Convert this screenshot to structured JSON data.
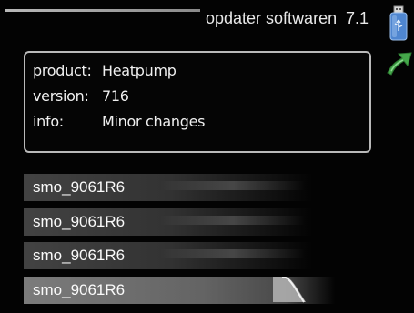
{
  "header": {
    "title": "opdater softwaren",
    "menu_number": "7.1"
  },
  "icons": {
    "usb": "usb-stick-icon",
    "back": "green-arrow-icon"
  },
  "info": {
    "product_label": "product:",
    "product_value": "Heatpump",
    "version_label": "version:",
    "version_value": "716",
    "info_label": "info:",
    "info_value": "Minor changes"
  },
  "files": [
    {
      "label": "smo_9061R6"
    },
    {
      "label": "smo_9061R6"
    },
    {
      "label": "smo_9061R6"
    },
    {
      "label": "smo_9061R6"
    }
  ],
  "colors": {
    "background": "#030303",
    "text": "#f2f2f2",
    "usb_blue": "#5a8fd6",
    "arrow_green": "#4caf50",
    "selected": "#8a8a8a"
  }
}
